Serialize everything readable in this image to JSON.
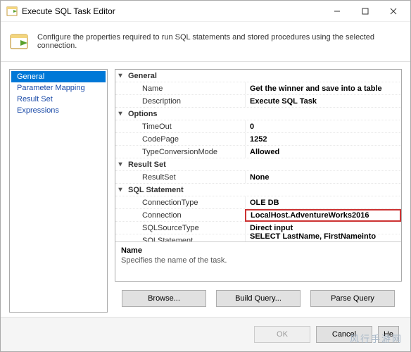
{
  "window": {
    "title": "Execute SQL Task Editor"
  },
  "info": {
    "text": "Configure the properties required to run SQL statements and stored procedures using the selected connection."
  },
  "sidebar": {
    "items": [
      {
        "label": "General",
        "selected": true
      },
      {
        "label": "Parameter Mapping",
        "selected": false
      },
      {
        "label": "Result Set",
        "selected": false
      },
      {
        "label": "Expressions",
        "selected": false
      }
    ]
  },
  "properties": {
    "groups": [
      {
        "name": "General",
        "rows": [
          {
            "key": "Name",
            "value": "Get the winner and save into a table",
            "bold": true
          },
          {
            "key": "Description",
            "value": "Execute SQL Task",
            "bold": true
          }
        ]
      },
      {
        "name": "Options",
        "rows": [
          {
            "key": "TimeOut",
            "value": "0",
            "bold": true
          },
          {
            "key": "CodePage",
            "value": "1252",
            "bold": true
          },
          {
            "key": "TypeConversionMode",
            "value": "Allowed",
            "bold": true
          }
        ]
      },
      {
        "name": "Result Set",
        "rows": [
          {
            "key": "ResultSet",
            "value": "None",
            "bold": true
          }
        ]
      },
      {
        "name": "SQL Statement",
        "rows": [
          {
            "key": "ConnectionType",
            "value": "OLE DB",
            "bold": true
          },
          {
            "key": "Connection",
            "value": "LocalHost.AdventureWorks2016",
            "bold": true,
            "highlighted": true
          },
          {
            "key": "SQLSourceType",
            "value": "Direct input",
            "bold": true
          },
          {
            "key": "SQLStatement",
            "value": "SELECT       LastName, FirstNameinto dbo.winn",
            "bold": true
          },
          {
            "key": "IsQueryStoredProcedure",
            "value": "False",
            "disabled": true
          },
          {
            "key": "BypassPrepare",
            "value": "True",
            "bold": true
          }
        ]
      }
    ]
  },
  "description_panel": {
    "name": "Name",
    "text": "Specifies the name of the task."
  },
  "action_buttons": {
    "browse": "Browse...",
    "build": "Build Query...",
    "parse": "Parse Query"
  },
  "footer": {
    "ok": "OK",
    "cancel": "Cancel",
    "help_truncated": "He"
  },
  "watermark": "风行手游网"
}
